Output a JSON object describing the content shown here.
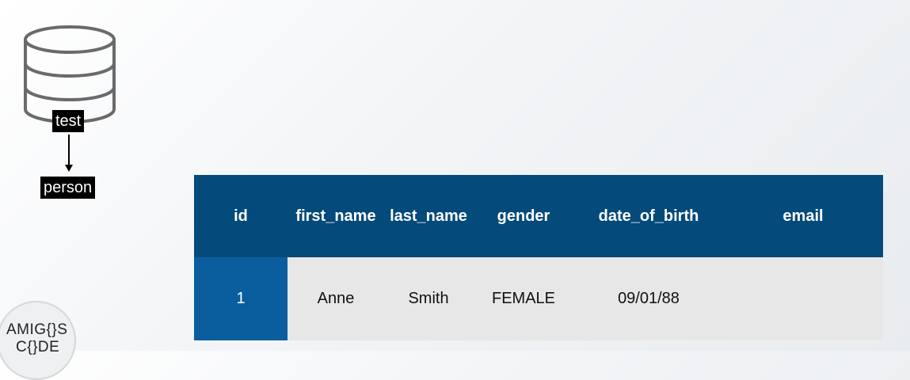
{
  "diagram": {
    "database_label": "test",
    "table_label": "person"
  },
  "table": {
    "headers": [
      "id",
      "first_name",
      "last_name",
      "gender",
      "date_of_birth",
      "email"
    ],
    "rows": [
      [
        "1",
        "Anne",
        "Smith",
        "FEMALE",
        "09/01/88",
        ""
      ]
    ]
  },
  "logo": {
    "line1": "AMIG{}S",
    "line2": "C{}DE"
  },
  "colors": {
    "header_bg": "#044a7a",
    "id_cell_bg": "#0a5e9e",
    "row_bg": "#e7e7e7"
  }
}
